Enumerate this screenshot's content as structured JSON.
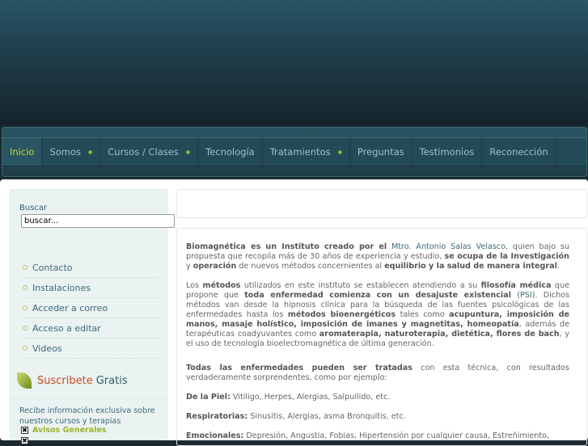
{
  "nav": {
    "items": [
      {
        "label": "Inicio",
        "active": true
      },
      {
        "label": "Somos",
        "sub": true
      },
      {
        "label": "Cursos / Clases",
        "sub": true
      },
      {
        "label": "Tecnología"
      },
      {
        "label": "Tratamientos",
        "sub": true
      },
      {
        "label": "Preguntas"
      },
      {
        "label": "Testimonios"
      },
      {
        "label": "Reconección"
      }
    ]
  },
  "sidebar": {
    "search_label": "Buscar",
    "search_value": "buscar...",
    "menu": [
      "Contacto",
      "Instalaciones",
      "Acceder a correo",
      "Acceso a editar",
      "Videos"
    ],
    "subscribe_a": "Suscribete",
    "subscribe_b": "Gratis",
    "subscribe_desc": "Recibe información exclusiva sobre nuestros cursos y terapias",
    "checkbox1": "Avisos Generales"
  },
  "content": {
    "p1": [
      {
        "b": "Biomagnética es un Instituto creado por el"
      },
      {
        "l": " Mtro. Antonio Salas Velasco"
      },
      {
        "t": ", quien bajo su propuesta que recopila más de 30 años de experiencia y estudio, "
      },
      {
        "b": "se ocupa de la Investigación"
      },
      {
        "t": " y "
      },
      {
        "b": "operación"
      },
      {
        "t": " de nuevos métodos concernientes al "
      },
      {
        "b": "equilibrio y la salud de manera integral"
      },
      {
        "t": "."
      }
    ],
    "p2": [
      {
        "t": "Los "
      },
      {
        "b": "métodos"
      },
      {
        "t": " utilizados en este instituto se establecen atendiendo a su "
      },
      {
        "b": "filosofía médica"
      },
      {
        "t": " que propone que "
      },
      {
        "b": "toda enfermedad comienza con un desajuste existencial"
      },
      {
        "l": " (PSI)"
      },
      {
        "t": ". Dichos métodos van desde la hipnosis clínica para la búsqueda de las fuentes psicológicas de las enfermedades hasta los "
      },
      {
        "b": "métodos bioenergéticos"
      },
      {
        "t": " tales como "
      },
      {
        "b": "acupuntura,  imposición de manos, masaje holístico, imposición de imanes y magnetitas, homeopatía"
      },
      {
        "t": ", además de terapéuticas coadyuvantes como "
      },
      {
        "b": "aromaterapia, naturoterapia, dietética, flores de bach"
      },
      {
        "t": ", y el uso de tecnología bioelectromagnética de última generación."
      }
    ],
    "p3": [
      {
        "b": "Todas las enfermedades pueden ser tratadas"
      },
      {
        "t": " con esta técnica, con resultados verdaderamente sorprendentes, como por  ejemplo:"
      }
    ],
    "p4": [
      {
        "b": "De la Piel:"
      },
      {
        "t": " Vitiligo, Herpes, Alergias, Salpullido, etc."
      }
    ],
    "p5": [
      {
        "b": "Respiratorias:"
      },
      {
        "t": " Sinusitis,  Alergias,  asma  Bronquitis, etc."
      }
    ],
    "p6": [
      {
        "b": "Emocionales:"
      },
      {
        "t": " Depresión, Angustia, Fobias, Hipertensión por cualquier  causa, Estreñimiento,"
      }
    ]
  }
}
